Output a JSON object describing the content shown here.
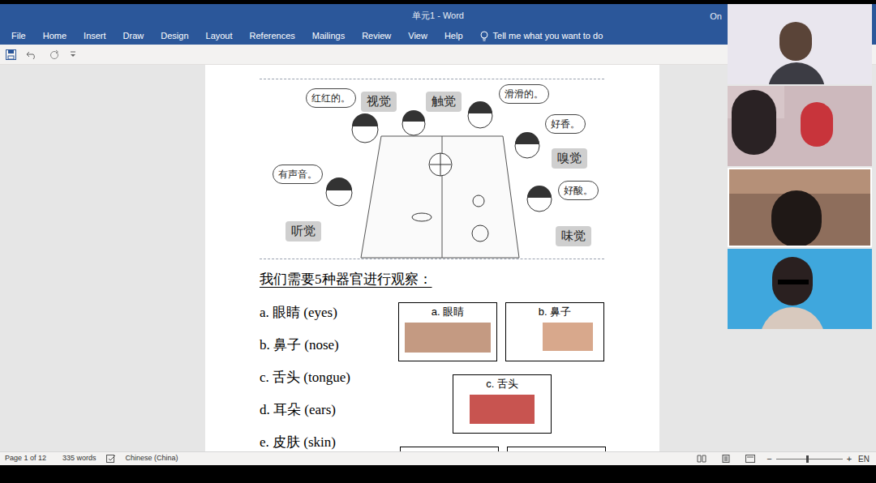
{
  "window": {
    "title": "单元1 - Word",
    "account": "On"
  },
  "ribbon": {
    "tabs": [
      "File",
      "Home",
      "Insert",
      "Draw",
      "Design",
      "Layout",
      "References",
      "Mailings",
      "Review",
      "View",
      "Help"
    ],
    "tell_me": "Tell me what you want to do"
  },
  "document": {
    "illustration": {
      "labels": [
        {
          "text": "红红的。",
          "kind": "bubble"
        },
        {
          "text": "视觉",
          "kind": "tag"
        },
        {
          "text": "触觉",
          "kind": "tag"
        },
        {
          "text": "滑滑的。",
          "kind": "bubble"
        },
        {
          "text": "好香。",
          "kind": "bubble"
        },
        {
          "text": "嗅觉",
          "kind": "tag"
        },
        {
          "text": "有声音。",
          "kind": "bubble"
        },
        {
          "text": "好酸。",
          "kind": "bubble"
        },
        {
          "text": "听觉",
          "kind": "tag"
        },
        {
          "text": "味觉",
          "kind": "tag"
        }
      ]
    },
    "heading": "我们需要5种器官进行观察：",
    "organs": [
      "a. 眼睛 (eyes)",
      "b. 鼻子 (nose)",
      "c. 舌头 (tongue)",
      "d. 耳朵 (ears)",
      "e. 皮肤 (skin)"
    ],
    "picture_cards": [
      {
        "caption": "a. 眼睛"
      },
      {
        "caption": "b. 鼻子"
      },
      {
        "caption": "c. 舌头"
      }
    ]
  },
  "status_bar": {
    "page": "Page 1 of 12",
    "words": "335 words",
    "language": "Chinese (China)",
    "zoom_out": "−",
    "zoom_in": "+",
    "zoom": {
      "level": 0.45
    },
    "input": "EN"
  }
}
